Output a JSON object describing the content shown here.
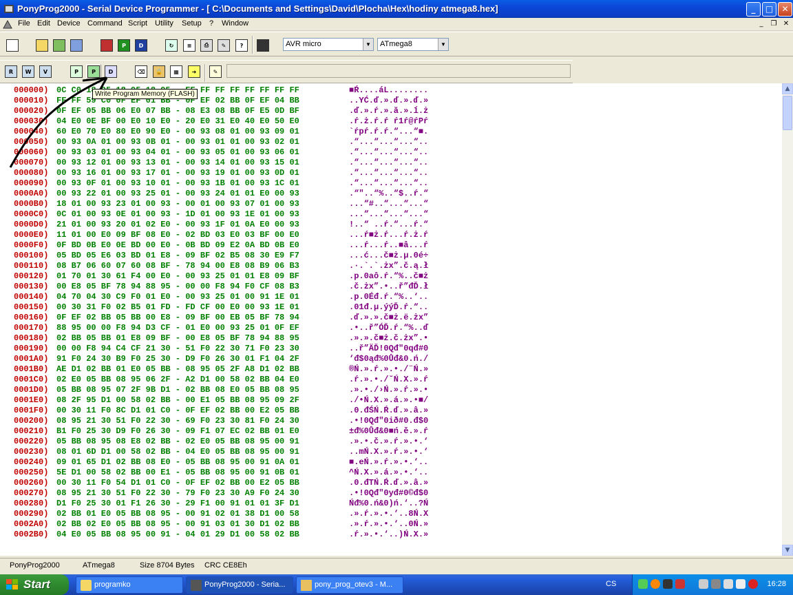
{
  "window": {
    "title": "PonyProg2000 - Serial Device Programmer - [ C:\\Documents and Settings\\David\\Plocha\\Hex\\hodiny atmega8.hex]",
    "min_label": "_",
    "max_label": "□",
    "close_label": "✕"
  },
  "menu": {
    "items": [
      "File",
      "Edit",
      "Device",
      "Command",
      "Script",
      "Utility",
      "Setup",
      "?",
      "Window"
    ],
    "mdi_min": "_",
    "mdi_restore": "❐",
    "mdi_close": "✕"
  },
  "toolbar": {
    "family_select": "AVR micro",
    "device_select": "ATmega8"
  },
  "tooltip": "Write Program Memory (FLASH)",
  "hex_rows": [
    {
      "addr": "000000)",
      "hex": "0C C0 18 95 18 95 18 95 - FF FF FF FF FF FF FF FF",
      "ascii": "■Ŕ....áL........"
    },
    {
      "addr": "000010)",
      "hex": "FF FF 59 C0 0F EF 01 BB - 0F EF 02 BB 0F EF 04 BB",
      "ascii": "..YĆ.ď.».ď.».ď.»"
    },
    {
      "addr": "000020)",
      "hex": "0F EF 05 BB 06 E0 07 BB - 08 E3 08 BB 0F E5 0D BF",
      "ascii": ".ď.».ŕ.».ă.».ĺ.ż"
    },
    {
      "addr": "000030)",
      "hex": "04 E0 0E BF 00 E0 10 E0 - 20 E0 31 E0 40 E0 50 E0",
      "ascii": ".ŕ.ż.ŕ.ŕ ŕ1ŕ@ŕPŕ"
    },
    {
      "addr": "000040)",
      "hex": "60 E0 70 E0 80 E0 90 E0 - 00 93 08 01 00 93 09 01",
      "ascii": "`ŕpŕ.ŕ.ŕ.“...“■."
    },
    {
      "addr": "000050)",
      "hex": "00 93 0A 01 00 93 0B 01 - 00 93 01 01 00 93 02 01",
      "ascii": ".“...“...“...“.."
    },
    {
      "addr": "000060)",
      "hex": "00 93 03 01 00 93 04 01 - 00 93 05 01 00 93 06 01",
      "ascii": ".“...“...“...“.."
    },
    {
      "addr": "000070)",
      "hex": "00 93 12 01 00 93 13 01 - 00 93 14 01 00 93 15 01",
      "ascii": ".“...“...“...“.."
    },
    {
      "addr": "000080)",
      "hex": "00 93 16 01 00 93 17 01 - 00 93 19 01 00 93 0D 01",
      "ascii": ".“...“...“...“.."
    },
    {
      "addr": "000090)",
      "hex": "00 93 0F 01 00 93 10 01 - 00 93 1B 01 00 93 1C 01",
      "ascii": ".“...“...“...“.."
    },
    {
      "addr": "0000A0)",
      "hex": "00 93 22 01 00 93 25 01 - 00 93 24 01 01 E0 00 93",
      "ascii": ".“\"..“%..“$..ŕ.“"
    },
    {
      "addr": "0000B0)",
      "hex": "18 01 00 93 23 01 00 93 - 00 01 00 93 07 01 00 93",
      "ascii": "...“#..“...“...“"
    },
    {
      "addr": "0000C0)",
      "hex": "0C 01 00 93 0E 01 00 93 - 1D 01 00 93 1E 01 00 93",
      "ascii": "...“...“...“...“"
    },
    {
      "addr": "0000D0)",
      "hex": "21 01 00 93 20 01 02 E0 - 00 93 1F 01 0A E0 00 93",
      "ascii": "!..“ ..ŕ.“...ŕ.“"
    },
    {
      "addr": "0000E0)",
      "hex": "11 01 00 E0 09 BF 08 E0 - 02 BD 03 E0 03 BF 00 E0",
      "ascii": "...ŕ■ż.ŕ...ŕ.ż.ŕ"
    },
    {
      "addr": "0000F0)",
      "hex": "0F BD 0B E0 0E BD 00 E0 - 0B BD 09 E2 0A BD 0B E0",
      "ascii": "...ŕ...ŕ..■â...ŕ"
    },
    {
      "addr": "000100)",
      "hex": "05 BD 05 E6 03 BD 01 E8 - 09 BF 02 B5 08 30 E9 F7",
      "ascii": "...ć...č■ż.µ.0é÷"
    },
    {
      "addr": "000110)",
      "hex": "08 B7 06 60 07 60 08 BF - 78 94 00 E8 08 B9 06 B3",
      "ascii": ".·.`.`.żx”.č.ą.ł"
    },
    {
      "addr": "000120)",
      "hex": "01 70 01 30 61 F4 00 E0 - 00 93 25 01 01 E8 09 BF",
      "ascii": ".p.0aô.ŕ.“%..č■ż"
    },
    {
      "addr": "000130)",
      "hex": "00 E8 05 BF 78 94 88 95 - 00 00 F8 94 F0 CF 08 B3",
      "ascii": ".č.żx”.•..ř”đĎ.ł"
    },
    {
      "addr": "000140)",
      "hex": "04 70 04 30 C9 F0 01 E0 - 00 93 25 01 00 91 1E 01",
      "ascii": ".p.0Éđ.ŕ.“%..‘.."
    },
    {
      "addr": "000150)",
      "hex": "00 30 31 F0 02 B5 01 FD - FD CF 00 E0 00 93 1E 01",
      "ascii": ".01đ.µ.ýýĎ.ŕ.“.."
    },
    {
      "addr": "000160)",
      "hex": "0F EF 02 BB 05 BB 00 E8 - 09 BF 00 EB 05 BF 78 94",
      "ascii": ".ď.».».č■ż.ë.żx”"
    },
    {
      "addr": "000170)",
      "hex": "88 95 00 00 F8 94 D3 CF - 01 E0 00 93 25 01 0F EF",
      "ascii": ".•..ř”ÓĎ.ŕ.“%..ď"
    },
    {
      "addr": "000180)",
      "hex": "02 BB 05 BB 01 E8 09 BF - 00 E8 05 BF 78 94 88 95",
      "ascii": ".».».č■ż.č.żx”.•"
    },
    {
      "addr": "000190)",
      "hex": "00 00 F8 94 C4 CF 21 30 - 51 F0 22 30 71 F0 23 30",
      "ascii": "..ř”ÄĎ!0Qđ\"0qđ#0"
    },
    {
      "addr": "0001A0)",
      "hex": "91 F0 24 30 B9 F0 25 30 - D9 F0 26 30 01 F1 04 2F",
      "ascii": "‘đ$0ąđ%0Ůđ&0.ń./"
    },
    {
      "addr": "0001B0)",
      "hex": "AE D1 02 BB 01 E0 05 BB - 08 95 05 2F A8 D1 02 BB",
      "ascii": "®Ń.».ŕ.».•./¨Ń.»"
    },
    {
      "addr": "0001C0)",
      "hex": "02 E0 05 BB 08 95 06 2F - A2 D1 00 58 02 BB 04 E0",
      "ascii": ".ŕ.».•./˘Ń.X.».ŕ"
    },
    {
      "addr": "0001D0)",
      "hex": "05 BB 08 95 07 2F 9B D1 - 02 BB 08 E0 05 BB 08 95",
      "ascii": ".».•./›Ń.».ŕ.».•"
    },
    {
      "addr": "0001E0)",
      "hex": "08 2F 95 D1 00 58 02 BB - 00 E1 05 BB 08 95 09 2F",
      "ascii": "./•Ń.X.».á.».•■/"
    },
    {
      "addr": "0001F0)",
      "hex": "00 30 11 F0 8C D1 01 C0 - 0F EF 02 BB 00 E2 05 BB",
      "ascii": ".0.đŚŃ.Ŕ.ď.».â.»"
    },
    {
      "addr": "000200)",
      "hex": "08 95 21 30 51 F0 22 30 - 69 F0 23 30 81 F0 24 30",
      "ascii": ".•!0Qđ\"0ið#0.đ$0"
    },
    {
      "addr": "000210)",
      "hex": "B1 F0 25 30 D9 F0 26 30 - 09 F1 07 EC 02 BB 01 E0",
      "ascii": "±đ%0Ůđ&0■ń.ě.».ŕ"
    },
    {
      "addr": "000220)",
      "hex": "05 BB 08 95 08 E8 02 BB - 02 E0 05 BB 08 95 00 91",
      "ascii": ".».•.č.».ŕ.».•.‘"
    },
    {
      "addr": "000230)",
      "hex": "08 01 6D D1 00 58 02 BB - 04 E0 05 BB 08 95 00 91",
      "ascii": "..mŃ.X.».ŕ.».•.‘"
    },
    {
      "addr": "000240)",
      "hex": "09 01 65 D1 02 BB 08 E0 - 05 BB 08 95 00 91 0A 01",
      "ascii": "■.eŃ.».ŕ.».•.‘.."
    },
    {
      "addr": "000250)",
      "hex": "5E D1 00 58 02 BB 00 E1 - 05 BB 08 95 00 91 0B 01",
      "ascii": "^Ń.X.».á.».•.‘.."
    },
    {
      "addr": "000260)",
      "hex": "00 30 11 F0 54 D1 01 C0 - 0F EF 02 BB 00 E2 05 BB",
      "ascii": ".0.đTŃ.Ŕ.ď.».â.»"
    },
    {
      "addr": "000270)",
      "hex": "08 95 21 30 51 F0 22 30 - 79 F0 23 30 A9 F0 24 30",
      "ascii": ".•!0Qđ\"0yđ#0©đ$0"
    },
    {
      "addr": "000280)",
      "hex": "D1 F0 25 30 01 F1 26 30 - 29 F1 00 91 01 01 3F D1",
      "ascii": "Ńđ%0.ń&0)ń.‘..?Ń"
    },
    {
      "addr": "000290)",
      "hex": "02 BB 01 E0 05 BB 08 95 - 00 91 02 01 38 D1 00 58",
      "ascii": ".».ŕ.».•.‘..8Ń.X"
    },
    {
      "addr": "0002A0)",
      "hex": "02 BB 02 E0 05 BB 08 95 - 00 91 03 01 30 D1 02 BB",
      "ascii": ".».ŕ.».•.‘..0Ń.»"
    },
    {
      "addr": "0002B0)",
      "hex": "04 E0 05 BB 08 95 00 91 - 04 01 29 D1 00 58 02 BB",
      "ascii": ".ŕ.».•.‘..)Ń.X.»"
    }
  ],
  "status": {
    "app": "PonyProg2000",
    "device": "ATmega8",
    "size": "Size  8704 Bytes",
    "crc": "CRC  CE8Eh"
  },
  "taskbar": {
    "start": "Start",
    "tasks": [
      "programko",
      "PonyProg2000 - Seria...",
      "pony_prog_otev3 - M..."
    ],
    "lang": "CS",
    "clock": "16:28"
  },
  "colors": {
    "address": "#c00000",
    "hex": "#008000",
    "ascii": "#800080"
  }
}
